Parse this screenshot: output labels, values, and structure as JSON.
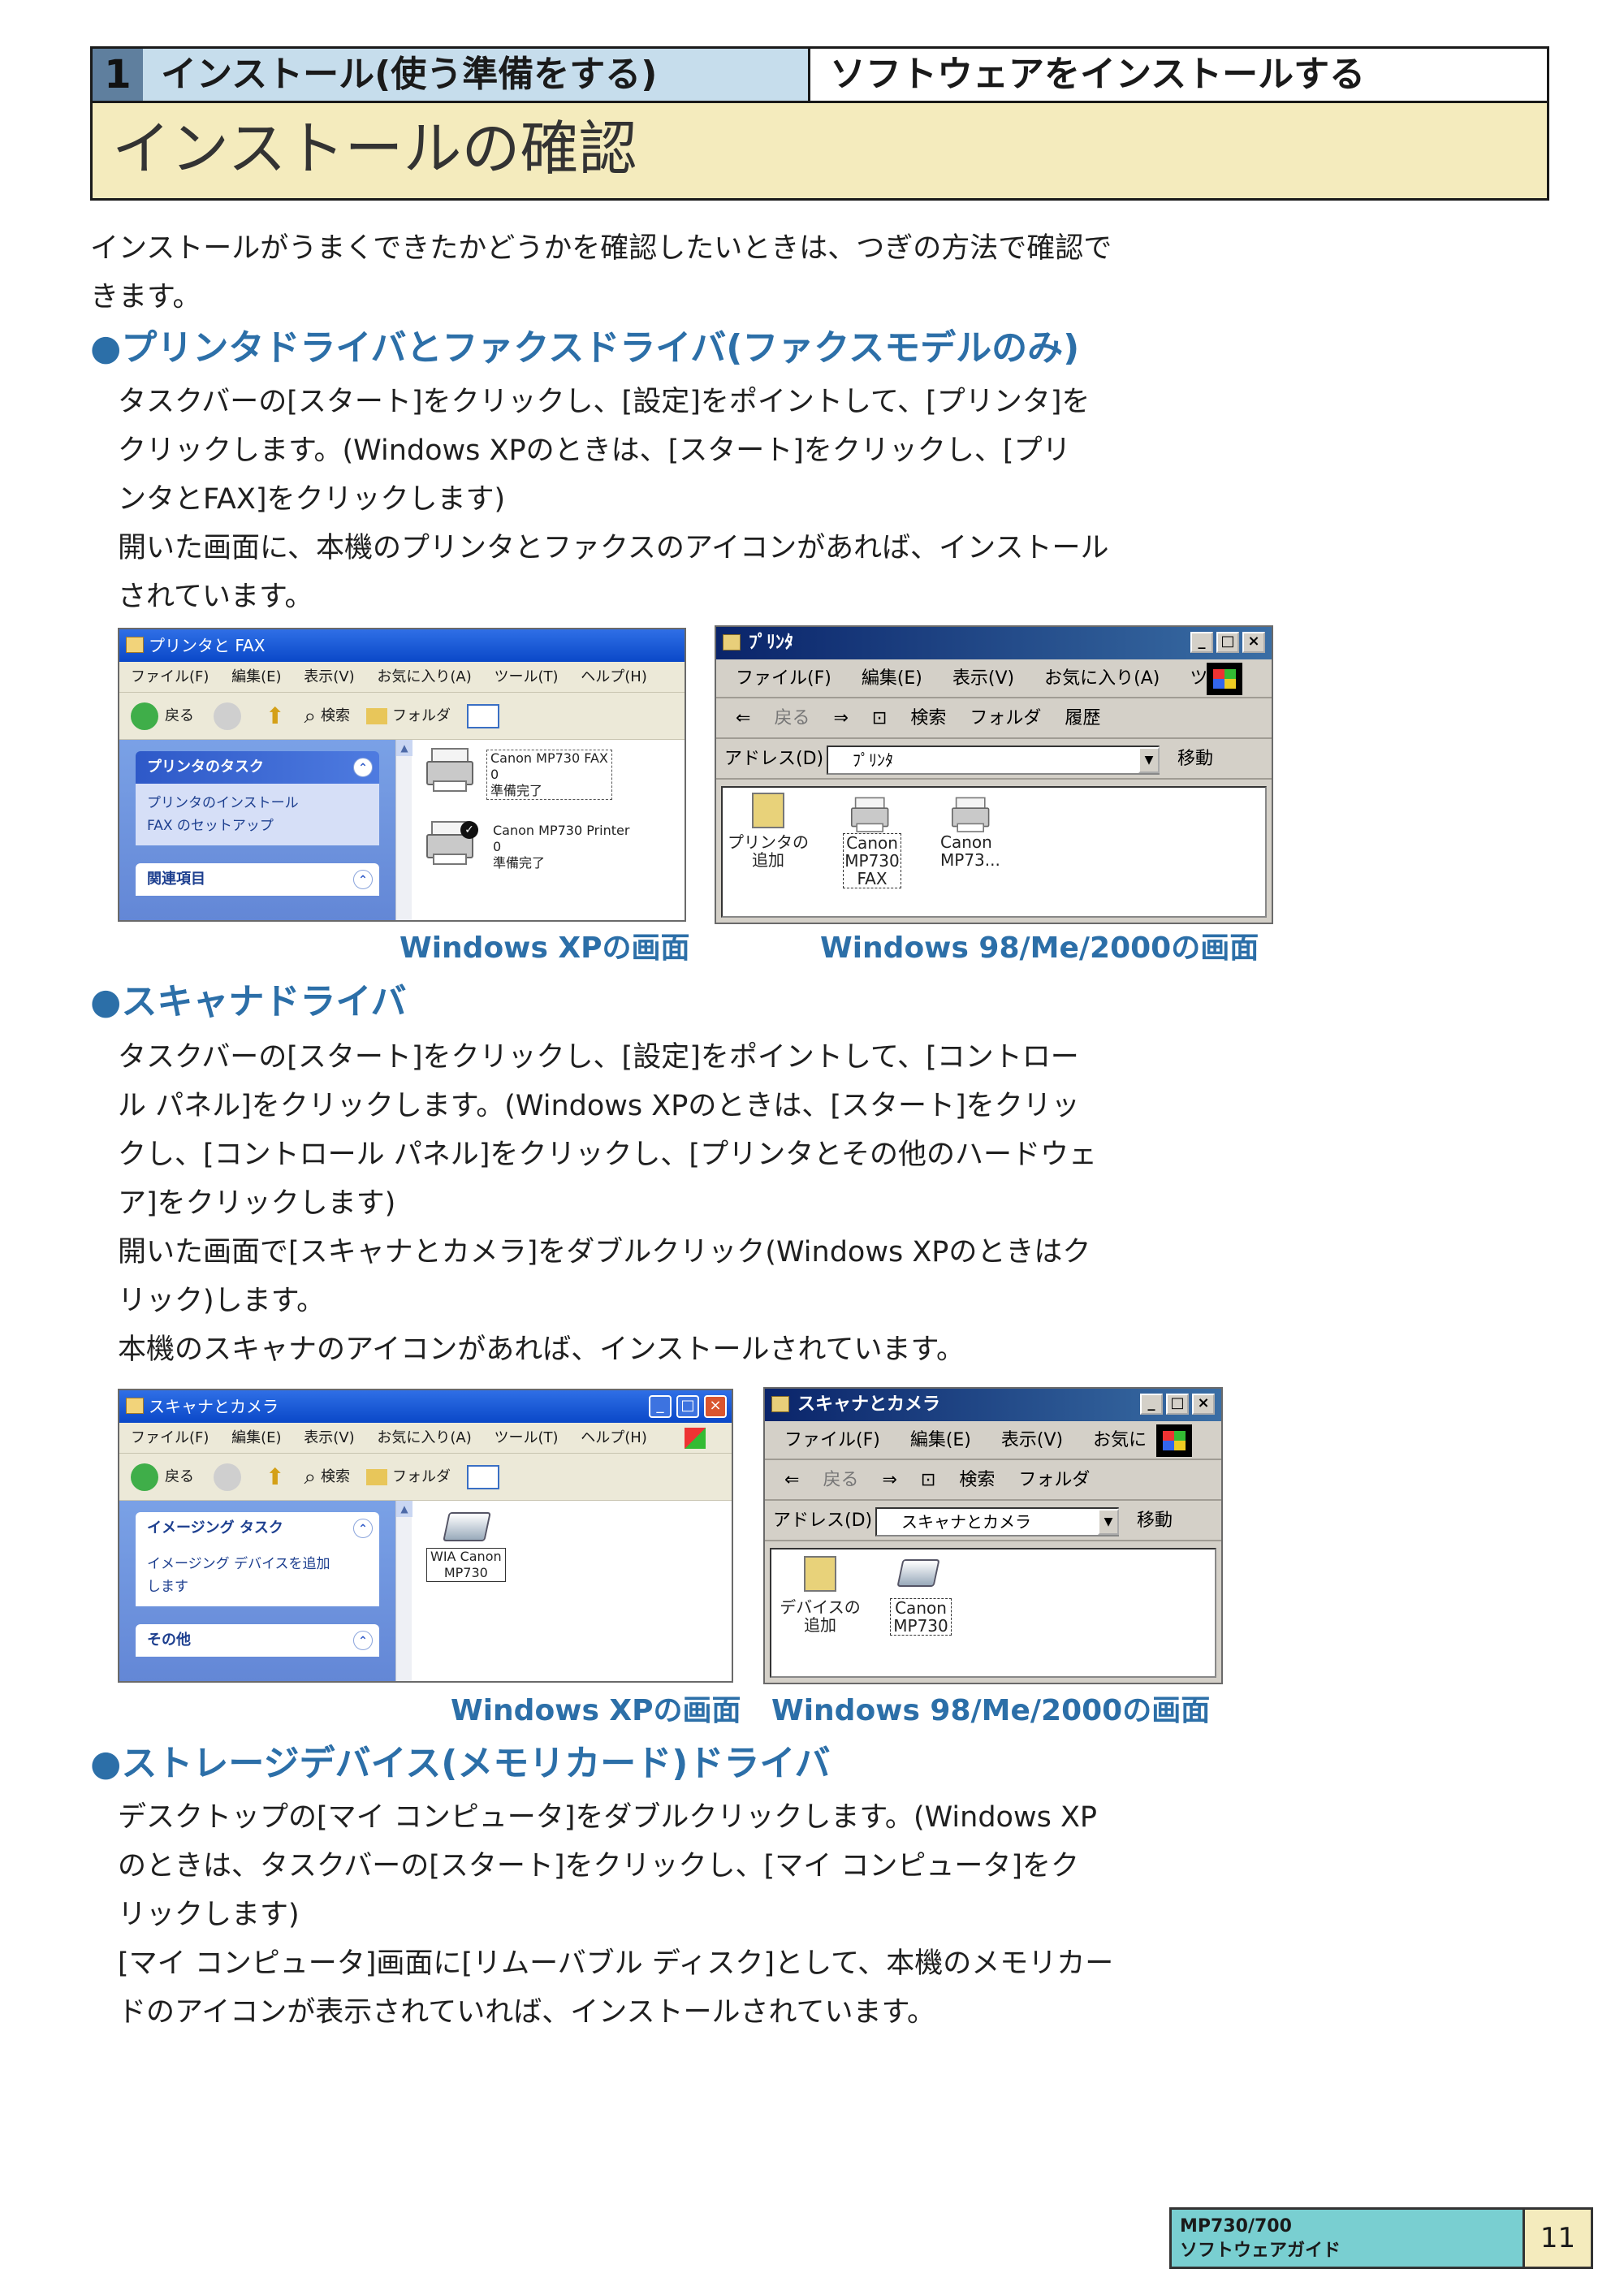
{
  "header": {
    "chapter_number": "1",
    "part_title": "インストール(使う準備をする)",
    "section_title": "ソフトウェアをインストールする",
    "page_title": "インストールの確認"
  },
  "intro": [
    "インストールがうまくできたかどうかを確認したいときは、つぎの方法で確認で",
    "きます。"
  ],
  "section1": {
    "heading": "●プリンタドライバとファクスドライバ(ファクスモデルのみ)",
    "lines": [
      "タスクバーの[スタート]をクリックし、[設定]をポイントして、[プリンタ]を",
      "クリックします。(Windows XPのときは、[スタート]をクリックし、[プリ",
      "ンタとFAX]をクリックします)",
      "開いた画面に、本機のプリンタとファクスのアイコンがあれば、インストール",
      "されています。"
    ],
    "xp_window": {
      "title": "プリンタと FAX",
      "menu": [
        "ファイル(F)",
        "編集(E)",
        "表示(V)",
        "お気に入り(A)",
        "ツール(T)",
        "ヘルプ(H)"
      ],
      "toolbar": [
        "戻る",
        "検索",
        "フォルダ"
      ],
      "panel1_title": "プリンタのタスク",
      "panel1_items": [
        "プリンタのインストール",
        "FAX のセットアップ"
      ],
      "panel2_title": "関連項目",
      "icons": [
        {
          "name": "Canon MP730 FAX",
          "sub1": "0",
          "sub2": "準備完了"
        },
        {
          "name": "Canon MP730 Printer",
          "sub1": "0",
          "sub2": "準備完了"
        }
      ]
    },
    "classic_window": {
      "title": "ﾌﾟﾘﾝﾀ",
      "menu": [
        "ファイル(F)",
        "編集(E)",
        "表示(V)",
        "お気に入り(A)",
        "ツ"
      ],
      "toolbar": [
        "戻る",
        "検索",
        "フォルダ",
        "履歴"
      ],
      "address_label": "アドレス(D)",
      "address_value": "ﾌﾟﾘﾝﾀ",
      "go_label": "移動",
      "icons": [
        "プリンタの追加",
        "Canon MP730 FAX",
        "Canon MP73..."
      ]
    },
    "caption_xp": "Windows XPの画面",
    "caption_classic": "Windows 98/Me/2000の画面"
  },
  "section2": {
    "heading": "●スキャナドライバ",
    "lines": [
      "タスクバーの[スタート]をクリックし、[設定]をポイントして、[コントロー",
      "ル パネル]をクリックします。(Windows XPのときは、[スタート]をクリッ",
      "クし、[コントロール パネル]をクリックし、[プリンタとその他のハードウェ",
      "ア]をクリックします)",
      "開いた画面で[スキャナとカメラ]をダブルクリック(Windows XPのときはク",
      "リック)します。",
      "本機のスキャナのアイコンがあれば、インストールされています。"
    ],
    "xp_window": {
      "title": "スキャナとカメラ",
      "menu": [
        "ファイル(F)",
        "編集(E)",
        "表示(V)",
        "お気に入り(A)",
        "ツール(T)",
        "ヘルプ(H)"
      ],
      "toolbar": [
        "戻る",
        "検索",
        "フォルダ"
      ],
      "panel1_title": "イメージング タスク",
      "panel1_items": [
        "イメージング デバイスを追加",
        "します"
      ],
      "panel2_title": "その他",
      "icons": [
        {
          "name": "WIA Canon",
          "sub1": "MP730"
        }
      ]
    },
    "classic_window": {
      "title": "スキャナとカメラ",
      "menu": [
        "ファイル(F)",
        "編集(E)",
        "表示(V)",
        "お気に"
      ],
      "toolbar": [
        "戻る",
        "検索",
        "フォルダ"
      ],
      "address_label": "アドレス(D)",
      "address_value": "スキャナとカメラ",
      "go_label": "移動",
      "icons": [
        "デバイスの追加",
        "Canon MP730"
      ]
    },
    "caption_xp": "Windows XPの画面",
    "caption_classic": "Windows 98/Me/2000の画面"
  },
  "section3": {
    "heading": "●ストレージデバイス(メモリカード)ドライバ",
    "lines": [
      "デスクトップの[マイ コンピュータ]をダブルクリックします。(Windows XP",
      "のときは、タスクバーの[スタート]をクリックし、[マイ コンピュータ]をク",
      "リックします)",
      "[マイ コンピュータ]画面に[リムーバブル ディスク]として、本機のメモリカー",
      "ドのアイコンが表示されていれば、インストールされています。"
    ]
  },
  "footer": {
    "model": "MP730/700",
    "guide": "ソフトウェアガイド",
    "page_number": "11"
  }
}
